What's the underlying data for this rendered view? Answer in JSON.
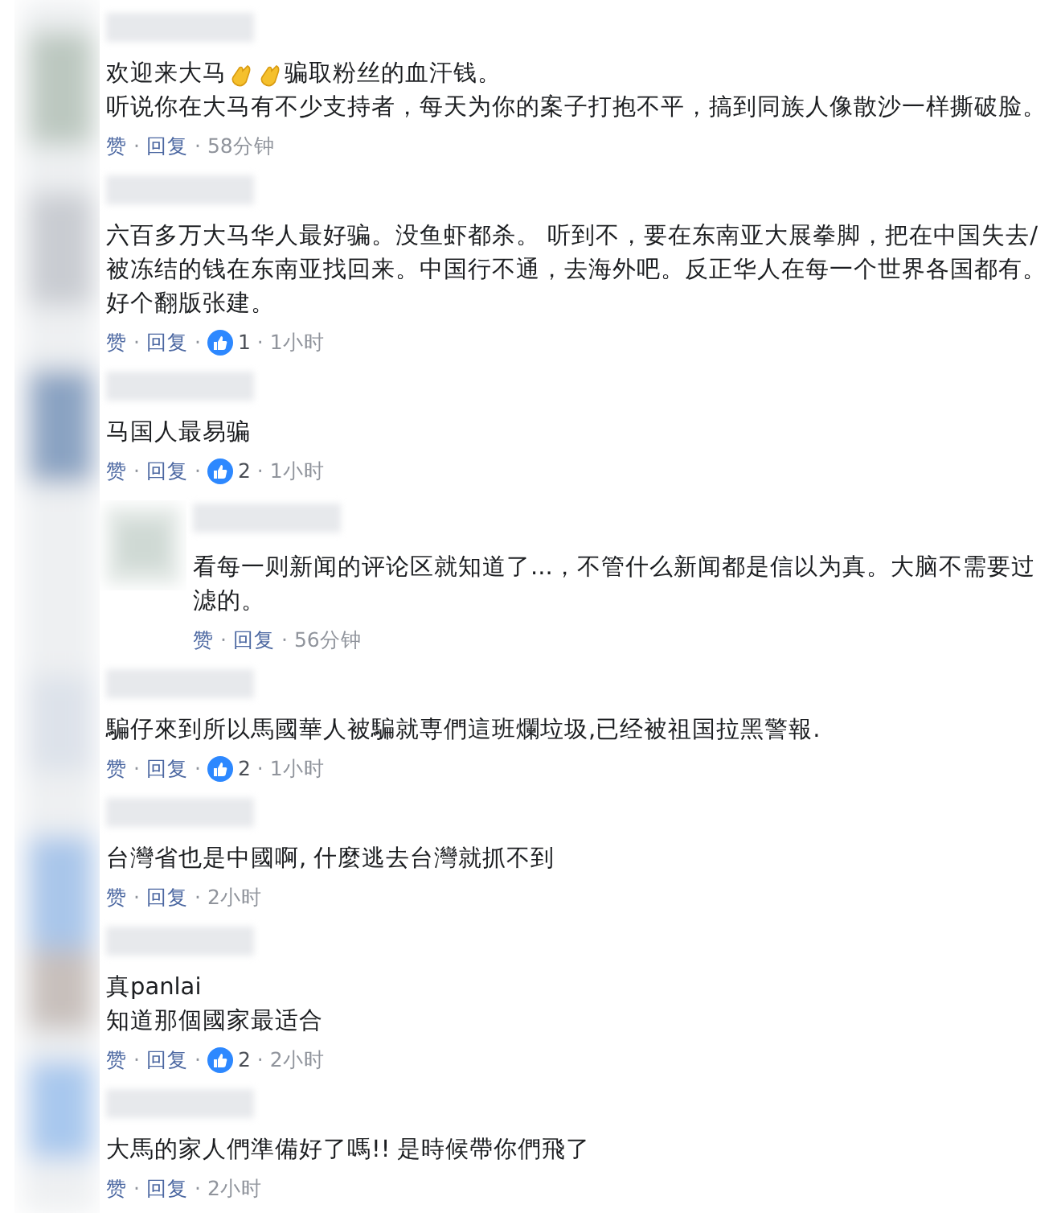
{
  "comments": [
    {
      "kind": "comment",
      "lines": [
        [
          {
            "kind": "text",
            "text": "欢迎来大马"
          },
          {
            "kind": "emoji"
          },
          {
            "kind": "emoji"
          },
          {
            "kind": "text",
            "text": "骗取粉丝的血汗钱。"
          }
        ],
        [
          {
            "kind": "text",
            "text": "听说你在大马有不少支持者，每天为你的案子打抱不平，搞到同族人像散沙一样撕破脸。"
          }
        ]
      ],
      "actions": [
        {
          "kind": "like",
          "text": "赞"
        },
        {
          "kind": "sep",
          "text": "·"
        },
        {
          "kind": "reply",
          "text": "回复"
        },
        {
          "kind": "sep",
          "text": "·"
        },
        {
          "kind": "time",
          "text": "58分钟"
        }
      ]
    },
    {
      "kind": "comment",
      "lines": [
        [
          {
            "kind": "text",
            "text": "六百多万大马华人最好骗。没鱼虾都杀。 听到不，要在东南亚大展拳脚，把在中国失去/"
          }
        ],
        [
          {
            "kind": "text",
            "text": "被冻结的钱在东南亚找回来。中国行不通，去海外吧。反正华人在每一个世界各国都有。"
          }
        ],
        [
          {
            "kind": "text",
            "text": "好个翻版张建。"
          }
        ]
      ],
      "actions": [
        {
          "kind": "like",
          "text": "赞"
        },
        {
          "kind": "sep",
          "text": "·"
        },
        {
          "kind": "reply",
          "text": "回复"
        },
        {
          "kind": "sep",
          "text": "·"
        },
        {
          "kind": "reactions",
          "text": "1"
        },
        {
          "kind": "sep",
          "text": "·"
        },
        {
          "kind": "time",
          "text": "1小时"
        }
      ]
    },
    {
      "kind": "comment",
      "lines": [
        [
          {
            "kind": "text",
            "text": "马国人最易骗"
          }
        ]
      ],
      "actions": [
        {
          "kind": "like",
          "text": "赞"
        },
        {
          "kind": "sep",
          "text": "·"
        },
        {
          "kind": "reply",
          "text": "回复"
        },
        {
          "kind": "sep",
          "text": "·"
        },
        {
          "kind": "reactions",
          "text": "2"
        },
        {
          "kind": "sep",
          "text": "·"
        },
        {
          "kind": "time",
          "text": "1小时"
        }
      ]
    },
    {
      "kind": "reply",
      "lines": [
        [
          {
            "kind": "text",
            "text": "看每一则新闻的评论区就知道了...，不管什么新闻都是信以为真。大脑不需要过"
          }
        ],
        [
          {
            "kind": "text",
            "text": "滤的。"
          }
        ]
      ],
      "actions": [
        {
          "kind": "like",
          "text": "赞"
        },
        {
          "kind": "sep",
          "text": "·"
        },
        {
          "kind": "reply",
          "text": "回复"
        },
        {
          "kind": "sep",
          "text": "·"
        },
        {
          "kind": "time",
          "text": "56分钟"
        }
      ]
    },
    {
      "kind": "comment",
      "lines": [
        [
          {
            "kind": "text",
            "text": "騙仔來到所以馬國華人被騙就専們這班爛垃圾,已经被祖国拉黑警報."
          }
        ]
      ],
      "actions": [
        {
          "kind": "like",
          "text": "赞"
        },
        {
          "kind": "sep",
          "text": "·"
        },
        {
          "kind": "reply",
          "text": "回复"
        },
        {
          "kind": "sep",
          "text": "·"
        },
        {
          "kind": "reactions",
          "text": "2"
        },
        {
          "kind": "sep",
          "text": "·"
        },
        {
          "kind": "time",
          "text": "1小时"
        }
      ]
    },
    {
      "kind": "comment",
      "lines": [
        [
          {
            "kind": "text",
            "text": "台灣省也是中國啊, 什麼逃去台灣就抓不到"
          }
        ]
      ],
      "actions": [
        {
          "kind": "like",
          "text": "赞"
        },
        {
          "kind": "sep",
          "text": "·"
        },
        {
          "kind": "reply",
          "text": "回复"
        },
        {
          "kind": "sep",
          "text": "·"
        },
        {
          "kind": "time",
          "text": "2小时"
        }
      ]
    },
    {
      "kind": "comment",
      "lines": [
        [
          {
            "kind": "text",
            "text": "真panlai"
          }
        ],
        [
          {
            "kind": "text",
            "text": "知道那個國家最适合"
          }
        ]
      ],
      "actions": [
        {
          "kind": "like",
          "text": "赞"
        },
        {
          "kind": "sep",
          "text": "·"
        },
        {
          "kind": "reply",
          "text": "回复"
        },
        {
          "kind": "sep",
          "text": "·"
        },
        {
          "kind": "reactions",
          "text": "2"
        },
        {
          "kind": "sep",
          "text": "·"
        },
        {
          "kind": "time",
          "text": "2小时"
        }
      ]
    },
    {
      "kind": "comment",
      "lines": [
        [
          {
            "kind": "text",
            "text": "大馬的家人們準備好了嗎!! 是時候帶你們飛了"
          }
        ]
      ],
      "actions": [
        {
          "kind": "like",
          "text": "赞"
        },
        {
          "kind": "sep",
          "text": "·"
        },
        {
          "kind": "reply",
          "text": "回复"
        },
        {
          "kind": "sep",
          "text": "·"
        },
        {
          "kind": "time",
          "text": "2小时"
        }
      ]
    }
  ]
}
